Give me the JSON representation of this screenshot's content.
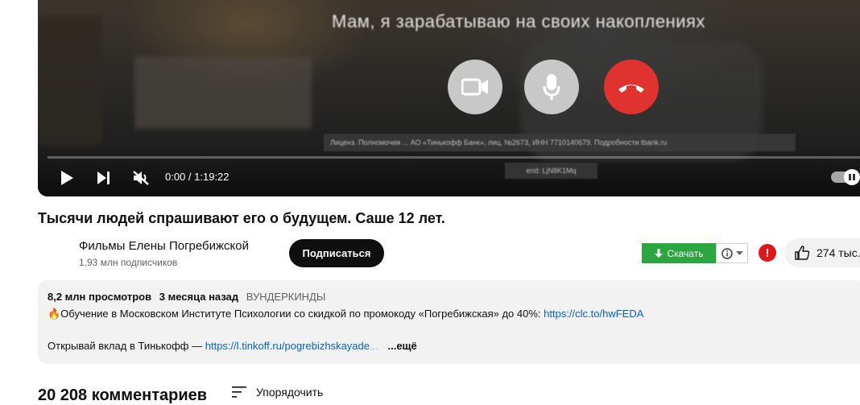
{
  "player": {
    "subtitle": "Мам, я зарабатываю на своих накоплениях",
    "legal_text": "Лиценз. Полномочия ... АО «Тинькофф Банк», лиц. №2673, ИНН 7710140679. Подробности tbank.ru",
    "legal_text2": "erid: LjN8K1Mq",
    "time": "0:00 / 1:19:22",
    "progress_fraction": 0,
    "icons": {
      "play": "play-icon",
      "next": "next-icon",
      "mute": "muted-speaker-icon",
      "camera": "video-camera-icon",
      "mic": "microphone-icon",
      "hangup": "phone-hangup-icon",
      "autoplay": "autoplay-pause-icon"
    }
  },
  "video": {
    "title": "Тысячи людей спрашивают его о будущем. Саше 12 лет."
  },
  "channel": {
    "name": "Фильмы Елены Погребижской",
    "subscribers": "1,93 млн подписчиков",
    "subscribe_label": "Подписаться"
  },
  "actions": {
    "download_label": "Скачать",
    "likes": "274 тыс."
  },
  "description": {
    "views": "8,2 млн просмотров",
    "date": "3 месяца назад",
    "hashtag": "ВУНДЕРКИНДЫ",
    "line1_text": "🔥Обучение в Московском Институте Психологии со скидкой по промокоду «Погребижская» до 40%: ",
    "line1_link": "https://clc.to/hwFEDA",
    "line2_text": "Открывай вклад в Тинькофф — ",
    "line2_link": "https://l.tinkoff.ru/pogrebizhskayade",
    "line2_fade": "...",
    "more_label": "...ещё"
  },
  "comments": {
    "count": "20 208 комментариев",
    "sort_label": "Упорядочить"
  },
  "colors": {
    "subscribe_bg": "#0f0f0f",
    "download_bg": "#2ba640",
    "link": "#065fd4",
    "hangup": "#e0322e",
    "alert": "#e0161b"
  }
}
